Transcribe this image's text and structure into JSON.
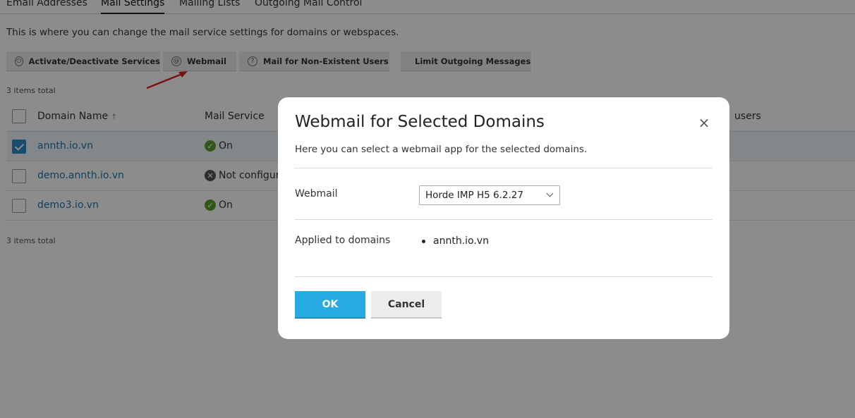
{
  "tabs": [
    {
      "label": "Email Addresses"
    },
    {
      "label": "Mail Settings"
    },
    {
      "label": "Mailing Lists"
    },
    {
      "label": "Outgoing Mail Control"
    }
  ],
  "intro_text": "This is where you can change the mail service settings for domains or webspaces.",
  "toolbar": {
    "activate_label": "Activate/Deactivate Services",
    "webmail_label": "Webmail",
    "nonexistent_label": "Mail for Non-Existent Users",
    "limit_label": "Limit Outgoing Messages"
  },
  "items_total": "3 items total",
  "table": {
    "columns": [
      "Domain Name",
      "Mail Service",
      "users"
    ],
    "sort_indicator": "↑",
    "rows": [
      {
        "domain": "annth.io.vn",
        "status": "On",
        "selected": true
      },
      {
        "domain": "demo.annth.io.vn",
        "status": "Not configured",
        "selected": false
      },
      {
        "domain": "demo3.io.vn",
        "status": "On",
        "selected": false
      }
    ]
  },
  "modal": {
    "title": "Webmail for Selected Domains",
    "description": "Here you can select a webmail app for the selected domains.",
    "webmail_label": "Webmail",
    "webmail_value": "Horde IMP H5 6.2.27",
    "applied_label": "Applied to domains",
    "applied_domains": [
      "annth.io.vn"
    ],
    "ok_label": "OK",
    "cancel_label": "Cancel",
    "close_glyph": "×"
  },
  "colors": {
    "accent": "#27a9e1",
    "link": "#1b78b3",
    "status_on": "#5aa02c",
    "annotation_arrow": "#e0201d"
  }
}
